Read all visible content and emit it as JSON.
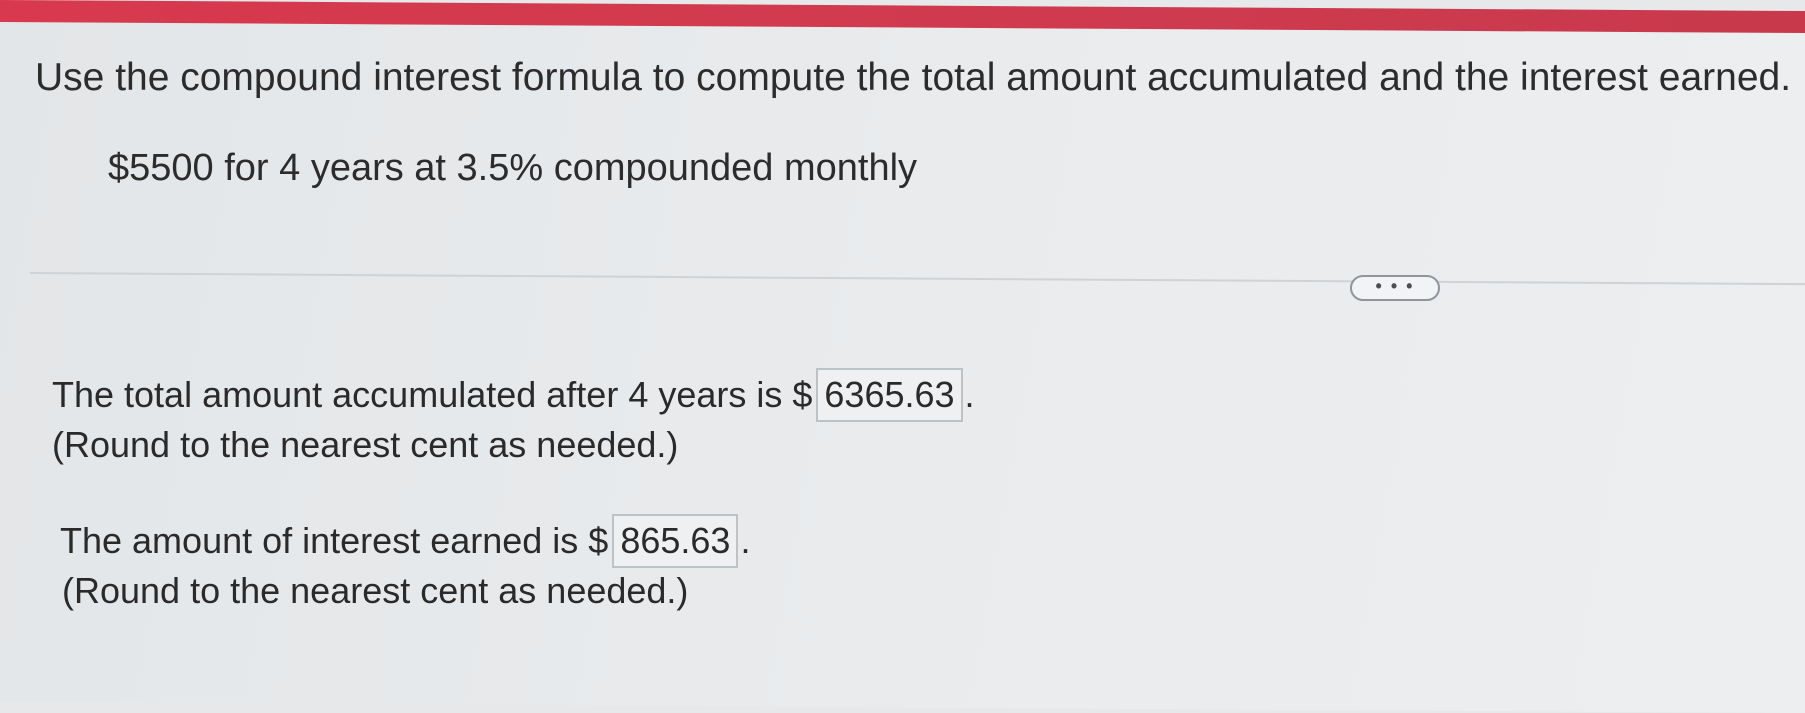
{
  "question": {
    "prompt": "Use the compound interest formula to compute the total amount accumulated and the interest earned.",
    "problem": "$5500 for 4 years at 3.5% compounded monthly"
  },
  "more_button": {
    "label": "• • •"
  },
  "answers": {
    "total": {
      "prefix": "The total amount accumulated after 4 years is $",
      "value": "6365.63",
      "suffix": ".",
      "note": "(Round to the nearest cent as needed.)"
    },
    "interest": {
      "prefix": "The amount of interest earned is $",
      "value": "865.63",
      "suffix": ".",
      "note": "(Round to the nearest cent as needed.)"
    }
  },
  "colors": {
    "accent_bar": "#d8394e",
    "background": "#e9ebed",
    "input_border": "#bcc2c6"
  }
}
